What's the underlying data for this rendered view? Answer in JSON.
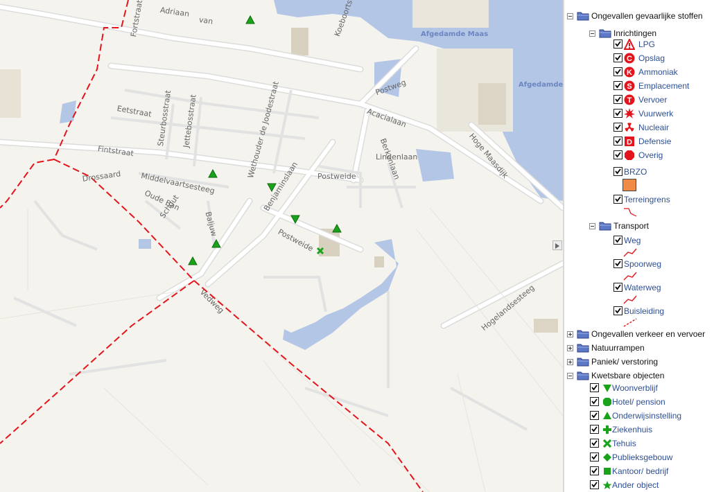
{
  "map": {
    "street_labels": [
      "Adriaan",
      "van",
      "Fortstraat",
      "Koeboortstraat",
      "Postweg",
      "Acacialaan",
      "Eetstraat",
      "Steurbosstraat",
      "Jettebosstraat",
      "Wethouder de Joodestraat",
      "Fintstraat",
      "Benjaminslaan",
      "Berkenlaan",
      "Lindenlaan",
      "Postweide",
      "Hoge Maasdijk",
      "Drossaard",
      "Middelvaartsesteeg",
      "Oude Ban",
      "Schout",
      "Baljuw",
      "Postweide",
      "Vedweg",
      "Hogelandsesteeg"
    ],
    "water_labels": [
      "Afgedamde Maas",
      "Afgedamde"
    ]
  },
  "legend": {
    "groups": [
      {
        "label": "Ongevallen gevaarlijke stoffen",
        "expanded": true
      },
      {
        "label": "Inrichtingen"
      },
      {
        "label": "Transport"
      },
      {
        "label": "Ongevallen verkeer en vervoer",
        "expanded": false
      },
      {
        "label": "Natuurrampen",
        "expanded": false
      },
      {
        "label": "Paniek/ verstoring",
        "expanded": false
      },
      {
        "label": "Kwetsbare objecten",
        "expanded": true
      }
    ],
    "inrichtingen": [
      {
        "label": "LPG",
        "icon": "lpg-triangle-icon",
        "checked": true
      },
      {
        "label": "Opslag",
        "icon": "opslag-c-icon",
        "checked": true
      },
      {
        "label": "Ammoniak",
        "icon": "ammoniak-k-icon",
        "checked": true
      },
      {
        "label": "Emplacement",
        "icon": "emplacement-s-icon",
        "checked": true
      },
      {
        "label": "Vervoer",
        "icon": "vervoer-t-icon",
        "checked": true
      },
      {
        "label": "Vuurwerk",
        "icon": "vuurwerk-explosion-icon",
        "checked": true
      },
      {
        "label": "Nucleair",
        "icon": "nucleair-radiation-icon",
        "checked": true
      },
      {
        "label": "Defensie",
        "icon": "defensie-d-icon",
        "checked": true
      },
      {
        "label": "Overig",
        "icon": "overig-octagon-icon",
        "checked": true
      }
    ],
    "brzo": {
      "label": "BRZO",
      "checked": true,
      "color": "#f08a47"
    },
    "terreingrens": {
      "label": "Terreingrens",
      "checked": true
    },
    "transport": [
      {
        "label": "Weg",
        "checked": true
      },
      {
        "label": "Spoorweg",
        "checked": true
      },
      {
        "label": "Waterweg",
        "checked": true
      },
      {
        "label": "Buisleiding",
        "checked": true
      }
    ],
    "kwetsbare": [
      {
        "label": "Woonverblijf",
        "icon": "down-triangle-icon",
        "checked": true
      },
      {
        "label": "Hotel/ pension",
        "icon": "octagon-icon",
        "checked": true
      },
      {
        "label": "Onderwijsinstelling",
        "icon": "up-triangle-icon",
        "checked": true
      },
      {
        "label": "Ziekenhuis",
        "icon": "plus-icon",
        "checked": true
      },
      {
        "label": "Tehuis",
        "icon": "x-icon",
        "checked": true
      },
      {
        "label": "Publieksgebouw",
        "icon": "diamond-icon",
        "checked": true
      },
      {
        "label": "Kantoor/ bedrijf",
        "icon": "square-icon",
        "checked": true
      },
      {
        "label": "Ander object",
        "icon": "star-icon",
        "checked": true
      }
    ],
    "colors": {
      "hazard_red": "#e3141b",
      "object_green": "#1aa31a",
      "link_blue": "#2e4f94",
      "water": "#b3c6e6"
    }
  }
}
